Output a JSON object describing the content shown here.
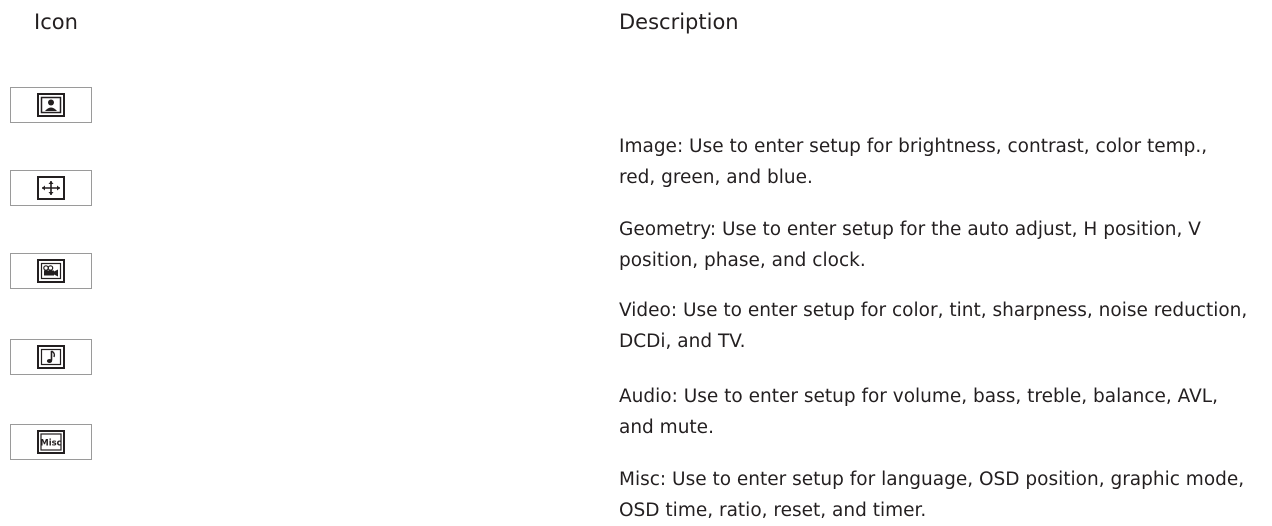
{
  "header": {
    "icon_col": "Icon",
    "desc_col": "Description"
  },
  "rows": [
    {
      "icon": "image-icon",
      "description": "Image: Use to enter setup for brightness, contrast, color temp., red, green, and blue."
    },
    {
      "icon": "geometry-icon",
      "description": "Geometry: Use to enter setup for the auto adjust, H position, V position, phase, and clock."
    },
    {
      "icon": "video-icon",
      "description": "Video: Use to enter setup for color, tint, sharpness, noise reduction, DCDi, and TV."
    },
    {
      "icon": "audio-icon",
      "description": "Audio: Use to enter setup for volume, bass, treble, balance, AVL, and mute."
    },
    {
      "icon": "misc-icon",
      "icon_text": "Misc",
      "description": "Misc: Use to enter setup for language, OSD position, graphic mode, OSD time, ratio, reset, and timer."
    }
  ]
}
